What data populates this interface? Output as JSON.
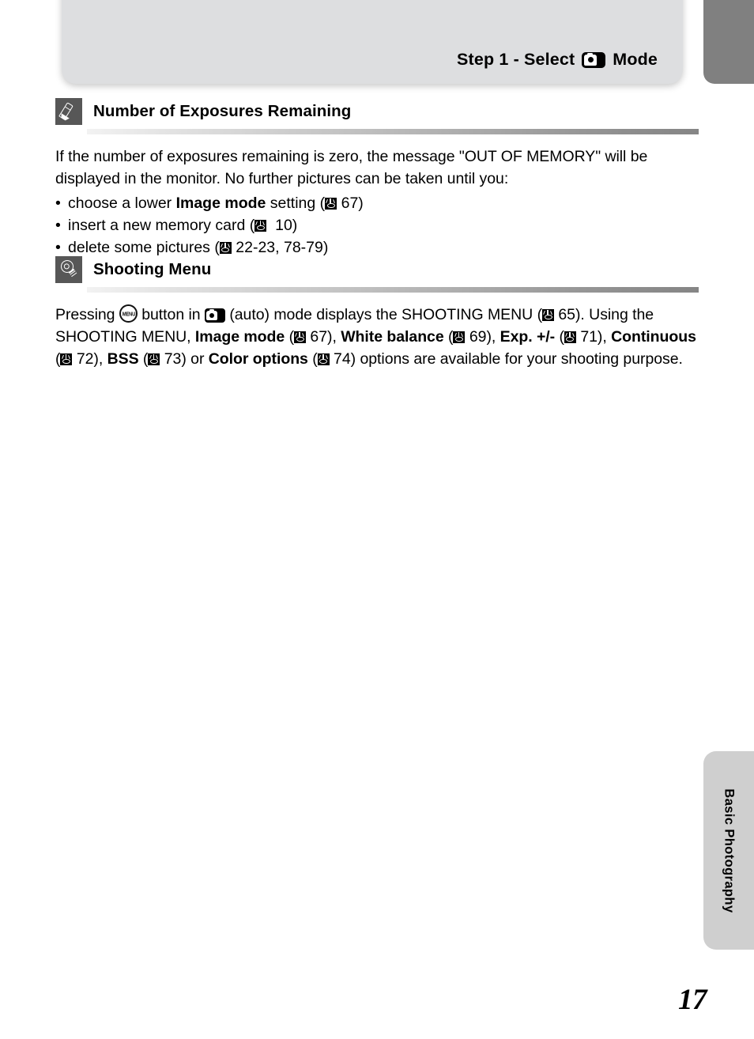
{
  "header": {
    "title_prefix": "Step 1 - Select",
    "mode_icon": "camera-auto-icon",
    "title_suffix": "Mode"
  },
  "sections": [
    {
      "badge_icon": "pencil-icon",
      "title": "Number of Exposures Remaining",
      "paragraph_part1": "If the number of exposures remaining is zero, the message \"OUT OF MEMORY\" will be displayed in the monitor. No further pictures can be taken until you:",
      "bullets": [
        {
          "dot": "•",
          "text_before": "choose a lower ",
          "bold": "Image mode",
          "text_mid": " setting (",
          "ref_icon": "book-reference-icon",
          "page_ref": "67",
          "text_after": ")"
        },
        {
          "dot": "•",
          "text_before": "insert a new memory card (",
          "bold": "",
          "text_mid": "",
          "ref_icon": "book-reference-icon",
          "page_ref": "10",
          "text_after": ")"
        },
        {
          "dot": "•",
          "text_before": "delete some pictures (",
          "bold": "",
          "text_mid": "",
          "ref_icon": "book-reference-icon",
          "page_ref": "22-23, 78-79",
          "text_after": ")"
        }
      ]
    },
    {
      "badge_icon": "lightbulb-icon",
      "title": "Shooting Menu",
      "paragraph": {
        "t1": "Pressing ",
        "menu_icon": "menu-button-icon",
        "t2": " button in ",
        "cam_icon": "camera-auto-icon",
        "t3": " (auto) mode displays the SHOOTING MENU (",
        "ref1": "book-reference-icon",
        "p1": "65",
        "t4": "). Using the SHOOTING MENU, ",
        "b1": "Image mode",
        "t5": " (",
        "ref2": "book-reference-icon",
        "p2": "67",
        "t6": "), ",
        "b2": "White balance",
        "t7": " (",
        "ref3": "book-reference-icon",
        "p3": "69",
        "t8": "), ",
        "b3": "Exp. +/-",
        "t9": " (",
        "ref4": "book-reference-icon",
        "p4": "71",
        "t10": "), ",
        "b4": "Continuous",
        "t11": " (",
        "ref5": "book-reference-icon",
        "p5": "72",
        "t12": "), ",
        "b5": "BSS",
        "t13": " (",
        "ref6": "book-reference-icon",
        "p6": "73",
        "t14": ") or ",
        "b6": "Color options",
        "t15": " (",
        "ref7": "book-reference-icon",
        "p7": "74",
        "t16": ") options are available for your shooting purpose."
      }
    }
  ],
  "side_tab": {
    "label": "Basic Photography"
  },
  "page_number": "17",
  "menu_button_label": "MENU",
  "colors": {
    "header_bar": "#dddee0",
    "top_right_tab": "#808080",
    "side_tab": "#cfcfcf",
    "badge": "#575757",
    "text": "#000000"
  }
}
